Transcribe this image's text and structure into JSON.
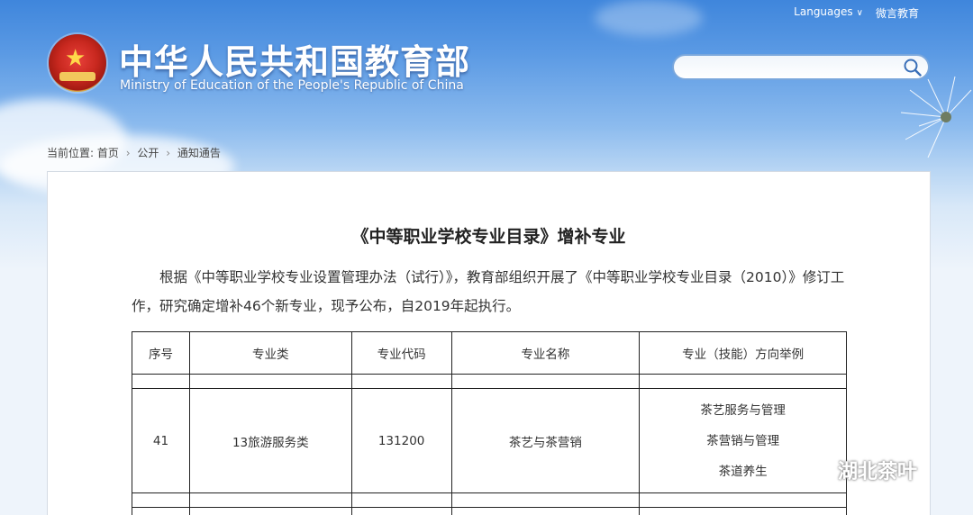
{
  "header": {
    "title_cn": "中华人民共和国教育部",
    "title_en": "Ministry of Education of the People's Republic of China",
    "links": {
      "languages": "Languages",
      "wechat": "微言教育"
    },
    "search": {
      "placeholder": ""
    },
    "icons": {
      "emblem": "national-emblem-icon",
      "search": "search-icon",
      "chevron": "chevron-down-icon"
    }
  },
  "breadcrumb": {
    "prefix": "当前位置:",
    "items": [
      "首页",
      "公开",
      "通知通告"
    ]
  },
  "document": {
    "title": "《中等职业学校专业目录》增补专业",
    "paragraph": "根据《中等职业学校专业设置管理办法（试行）》，教育部组织开展了《中等职业学校专业目录（2010）》修订工作，研究确定增补46个新专业，现予公布，自2019年起执行。",
    "table": {
      "headers": [
        "序号",
        "专业类",
        "专业代码",
        "专业名称",
        "专业（技能）方向举例"
      ],
      "row": {
        "seq": "41",
        "category": "13旅游服务类",
        "code": "131200",
        "name": "茶艺与茶营销",
        "directions": [
          "茶艺服务与管理",
          "茶营销与管理",
          "茶道养生"
        ]
      }
    }
  },
  "watermark": {
    "text": "湖北茶叶",
    "icon": "wechat-icon"
  },
  "colors": {
    "sky_top": "#3f86dc",
    "panel": "#ffffff",
    "search_border": "#7aa7dc"
  }
}
